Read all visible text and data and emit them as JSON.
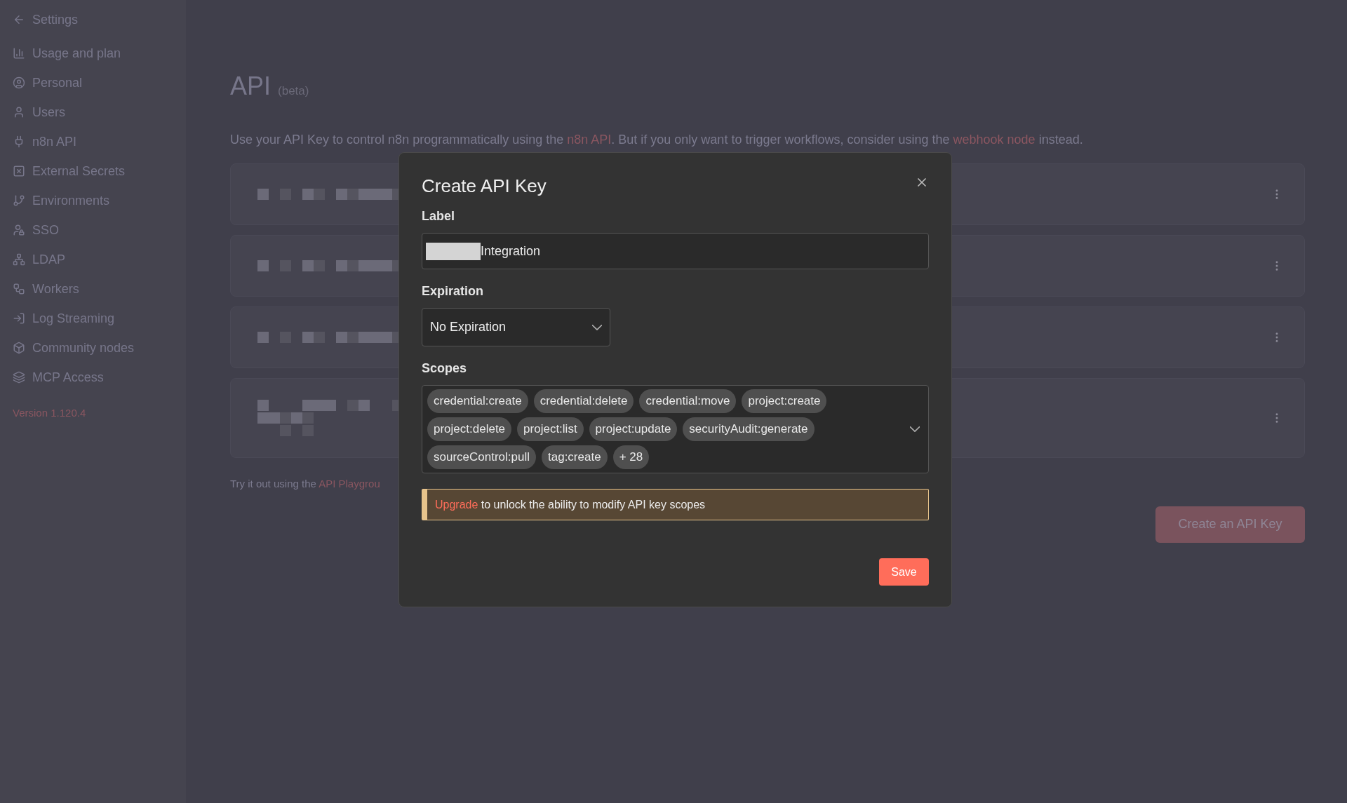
{
  "sidebar": {
    "back_label": "Settings",
    "items": [
      {
        "label": "Usage and plan"
      },
      {
        "label": "Personal"
      },
      {
        "label": "Users"
      },
      {
        "label": "n8n API"
      },
      {
        "label": "External Secrets"
      },
      {
        "label": "Environments"
      },
      {
        "label": "SSO"
      },
      {
        "label": "LDAP"
      },
      {
        "label": "Workers"
      },
      {
        "label": "Log Streaming"
      },
      {
        "label": "Community nodes"
      },
      {
        "label": "MCP Access"
      }
    ],
    "version": "Version 1.120.4"
  },
  "page": {
    "title": "API",
    "title_badge": "(beta)",
    "description": [
      "Use your API Key to control n8n programmatically using the ",
      "n8n API",
      ". But if you only want to trigger workflows, consider using the ",
      "webhook node",
      " instead."
    ],
    "cards": [
      {
        "kind": "short"
      },
      {
        "kind": "short"
      },
      {
        "kind": "short"
      },
      {
        "kind": "tall"
      }
    ],
    "footer": [
      "Try it out using the ",
      "API Playgrou"
    ],
    "create_button": "Create an API Key"
  },
  "dialog": {
    "title": "Create API Key",
    "label_field": {
      "label": "Label",
      "value": "Integration"
    },
    "expiration": {
      "label": "Expiration",
      "value": "No Expiration"
    },
    "scopes": {
      "label": "Scopes",
      "chips": [
        "credential:create",
        "credential:delete",
        "credential:move",
        "project:create",
        "project:delete",
        "project:list",
        "project:update",
        "securityAudit:generate",
        "sourceControl:pull",
        "tag:create",
        "+ 28"
      ]
    },
    "notice": {
      "link": "Upgrade",
      "text": " to unlock the ability to modify API key scopes"
    },
    "save_button": "Save"
  }
}
